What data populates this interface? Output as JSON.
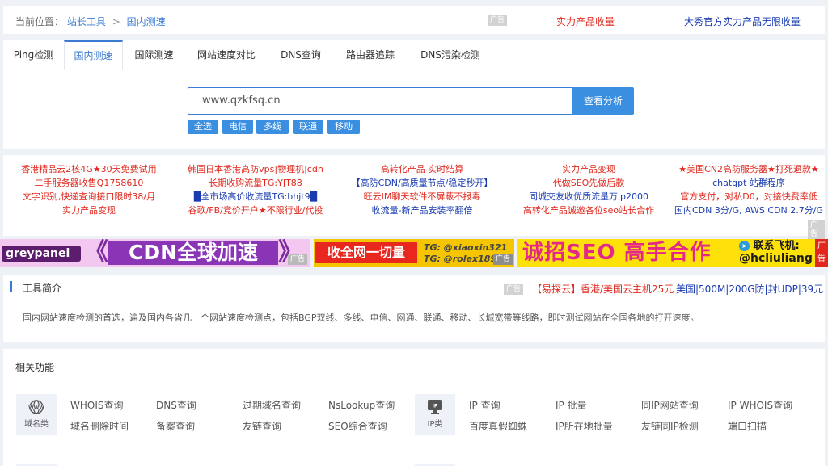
{
  "breadcrumb": {
    "label": "当前位置：",
    "home": "站长工具",
    "separator": ">",
    "current": "国内测速",
    "ad_tag": "广告",
    "ad1": "实力产品收量",
    "ad2": "大秀官方实力产品无限收量"
  },
  "tabs": [
    "Ping检测",
    "国内测速",
    "国际测速",
    "网站速度对比",
    "DNS查询",
    "路由器追踪",
    "DNS污染检测"
  ],
  "search": {
    "value": "www.qzkfsq.cn",
    "button": "查看分析"
  },
  "line_filters": [
    "全选",
    "电信",
    "多线",
    "联通",
    "移动"
  ],
  "text_ads": {
    "columns": [
      [
        "香港精品云2核4G★30天免费试用",
        "二手服务器收售Q1758610",
        "文字识别,快递查询接口限时38/月",
        "实力产品变现"
      ],
      [
        "韩国日本香港高防vps|物理机|cdn",
        "长期收购流量TG:YJT88",
        "█全市场高价收流量TG:bhjt9█",
        "谷歌/FB/竞价开户★不限行业/代投"
      ],
      [
        "高转化产品 实时结算",
        "【高防CDN/高质量节点/稳定秒开】",
        "旺云IM聊天软件不屏蔽不报毒",
        "收流量-新产品安装率翻倍"
      ],
      [
        "实力产品变现",
        "代做SEO先做后款",
        "同城交友收优质流量万ip2000",
        "高转化产品诚邀各位seo站长合作"
      ],
      [
        "★美国CN2高防服务器★打死退款★",
        "chatgpt 站群程序",
        "官方支付，对私D0，对接快费率低",
        "国内CDN 3分/G, AWS CDN 2.7分/G"
      ]
    ],
    "ad_tag": "广告"
  },
  "banners": {
    "b1_logo": "greypanel",
    "b1_arrow_left": "《",
    "b1_text": "CDN全球加速",
    "b1_arrow_right": "》",
    "b1_tag": "广告",
    "b2_text": "收全网一切量",
    "b2_tg1": "TG: @xiaoxin321",
    "b2_tg2": "TG: @rolex1899",
    "b2_tag": "广告",
    "b3_text": "诚招SEO 高手合作",
    "b3_tg1": "联系飞机:",
    "b3_tg2": "@hcliuliang",
    "b3_tag": "广告"
  },
  "intro": {
    "title": "工具简介",
    "ad_tag": "广告",
    "ad1": "【易探云】香港/美国云主机25元",
    "ad2": "美国|500M|200G防|封UDP|39元",
    "description": "国内网站速度检测的首选，遍及国内各省几十个网站速度检测点，包括BGP双线、多线、电信、网通、联通、移动、长城宽带等线路，即时测试网站在全国各地的打开速度。"
  },
  "related": {
    "title": "相关功能",
    "domain_cat": "域名类",
    "domain_icon_text": "WWW",
    "domain_links": [
      "WHOIS查询",
      "DNS查询",
      "过期域名查询",
      "NsLookup查询",
      "域名删除时间",
      "备案查询",
      "友链查询",
      "SEO综合查询"
    ],
    "ip_cat": "IP类",
    "ip_icon_text": "IP",
    "ip_links": [
      "IP 查询",
      "IP 批量",
      "同IP网站查询",
      "IP WHOIS查询",
      "百度真假蜘蛛",
      "IP所在地批量",
      "友链同IP检测",
      "端口扫描"
    ]
  },
  "colors": {
    "accent": "#3b7bd4",
    "button": "#3b8fe0",
    "ad_red": "#e0281e",
    "ad_blue": "#1a3cb0"
  }
}
